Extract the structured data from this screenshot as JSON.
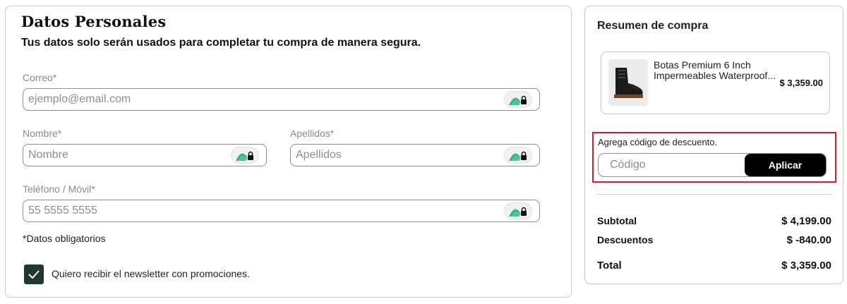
{
  "personal": {
    "title": "Datos Personales",
    "subtitle": "Tus datos solo serán usados para completar tu compra de manera segura.",
    "email": {
      "label": "Correo*",
      "placeholder": "ejemplo@email.com",
      "value": ""
    },
    "first_name": {
      "label": "Nombre*",
      "placeholder": "Nombre",
      "value": ""
    },
    "last_name": {
      "label": "Apellidos*",
      "placeholder": "Apellidos",
      "value": ""
    },
    "phone": {
      "label": "Teléfono / Móvil*",
      "placeholder": "55 5555 5555",
      "value": ""
    },
    "required_note": "*Datos obligatorios",
    "newsletter": {
      "label": "Quiero recibir el newsletter con promociones.",
      "checked": true
    }
  },
  "summary": {
    "title": "Resumen de compra",
    "product": {
      "name_line1": "Botas Premium 6 Inch",
      "name_line2": "Impermeables Waterproof...",
      "price": "$ 3,359.00",
      "image_icon": "boot-icon"
    },
    "discount": {
      "label": "Agrega código de descuento.",
      "placeholder": "Código",
      "value": "",
      "button_label": "Aplicar"
    },
    "subtotal": {
      "label": "Subtotal",
      "value": "$ 4,199.00"
    },
    "discounts": {
      "label": "Descuentos",
      "value": "$ -840.00"
    },
    "total": {
      "label": "Total",
      "value": "$ 3,359.00"
    }
  },
  "colors": {
    "checkbox": "#1f3a2b",
    "highlight_border": "#d0202c",
    "apply_button": "#000000",
    "password_manager_icon": "#4fc3a1"
  },
  "icons": [
    "password-manager-icon",
    "lock-icon",
    "check-icon",
    "boot-icon"
  ]
}
